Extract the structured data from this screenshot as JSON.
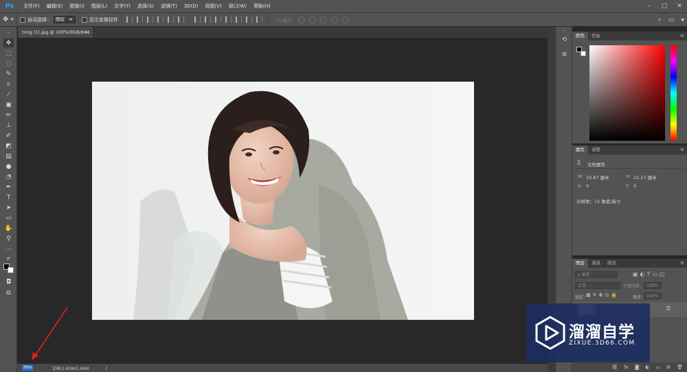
{
  "app": {
    "logo": "Ps"
  },
  "menu": [
    "文件(F)",
    "编辑(E)",
    "图像(I)",
    "图层(L)",
    "文字(Y)",
    "选择(S)",
    "滤镜(T)",
    "3D(D)",
    "视图(V)",
    "窗口(W)",
    "帮助(H)"
  ],
  "options": {
    "auto_select_label": "自动选择：",
    "auto_select_value": "图层",
    "show_transform_label": "显示变换控件",
    "mode_3d_label": "3D 模式："
  },
  "document": {
    "tab_title": "timg (1).jpg @ 100%(RGB/8#)",
    "tab_close": "×"
  },
  "status": {
    "zoom": "76%",
    "doc_size": "文档:1.65M/1.65M",
    "arrow": "〉"
  },
  "color_panel": {
    "tabs": [
      "颜色",
      "色板"
    ],
    "base_hue": "#ff0000"
  },
  "properties_panel": {
    "tabs": [
      "属性",
      "调整"
    ],
    "doc_props": "文档属性",
    "w_label": "W:",
    "w_value": "33.87 厘米",
    "h_label": "H:",
    "h_value": "21.17 厘米",
    "x_label": "X:",
    "x_value": "0",
    "y_label": "Y:",
    "y_value": "0",
    "resolution": "分辨率：72 像素/英寸"
  },
  "layers_panel": {
    "tabs": [
      "图层",
      "通道",
      "路径"
    ],
    "kind": "ρ 类型",
    "blend": "正常",
    "opacity_label": "不透明度：",
    "opacity_value": "100%",
    "lock_label": "锁定：",
    "fill_label": "填充：",
    "fill_value": "100%"
  },
  "watermark": {
    "title": "溜溜自学",
    "url": "ZIXUE.3D66.COM"
  }
}
